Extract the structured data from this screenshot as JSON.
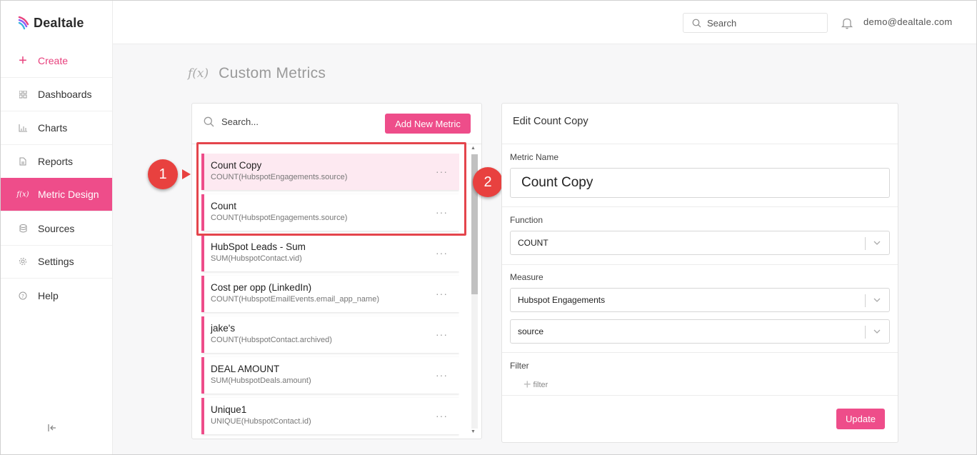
{
  "brand": {
    "name": "Dealtale"
  },
  "sidebar": {
    "items": [
      {
        "label": "Create",
        "icon": "plus-icon"
      },
      {
        "label": "Dashboards",
        "icon": "dashboard-icon"
      },
      {
        "label": "Charts",
        "icon": "chart-icon"
      },
      {
        "label": "Reports",
        "icon": "report-icon"
      },
      {
        "label": "Metric Design",
        "icon": "fx-icon"
      },
      {
        "label": "Sources",
        "icon": "database-icon"
      },
      {
        "label": "Settings",
        "icon": "gear-icon"
      },
      {
        "label": "Help",
        "icon": "help-icon"
      }
    ],
    "active": "Metric Design"
  },
  "topbar": {
    "search_placeholder": "Search",
    "user_email": "demo@dealtale.com"
  },
  "page": {
    "title_icon": "f(x)",
    "title": "Custom Metrics"
  },
  "list": {
    "search_placeholder": "Search...",
    "add_button": "Add New Metric",
    "items": [
      {
        "name": "Count Copy",
        "formula": "COUNT(HubspotEngagements.source)",
        "selected": true
      },
      {
        "name": "Count",
        "formula": "COUNT(HubspotEngagements.source)"
      },
      {
        "name": "HubSpot Leads - Sum",
        "formula": "SUM(HubspotContact.vid)"
      },
      {
        "name": "Cost per opp (LinkedIn)",
        "formula": "COUNT(HubspotEmailEvents.email_app_name)"
      },
      {
        "name": "jake's",
        "formula": "COUNT(HubspotContact.archived)"
      },
      {
        "name": "DEAL AMOUNT",
        "formula": "SUM(HubspotDeals.amount)"
      },
      {
        "name": "Unique1",
        "formula": "UNIQUE(HubspotContact.id)"
      }
    ],
    "item_menu": "···"
  },
  "callouts": {
    "one": "1",
    "two": "2"
  },
  "edit": {
    "title": "Edit Count Copy",
    "metric_name_label": "Metric Name",
    "metric_name_value": "Count Copy",
    "function_label": "Function",
    "function_value": "COUNT",
    "measure_label": "Measure",
    "measure_table": "Hubspot Engagements",
    "measure_field": "source",
    "filter_label": "Filter",
    "filter_add": "filter",
    "update_button": "Update"
  },
  "colors": {
    "accent": "#ee4d8a",
    "callout": "#e8413f",
    "selected_row": "#fde9f1"
  }
}
